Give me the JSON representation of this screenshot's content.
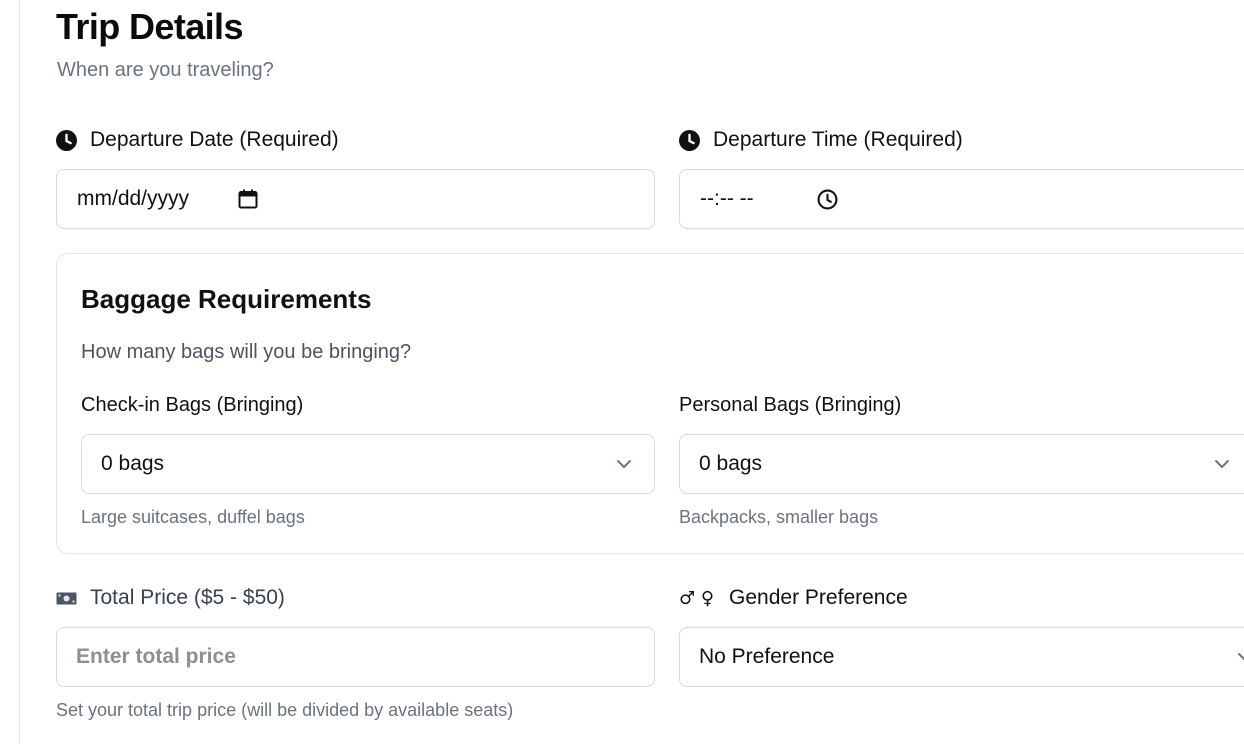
{
  "header": {
    "title": "Trip Details",
    "subtitle": "When are you traveling?"
  },
  "departure_date": {
    "label": "Departure Date (Required)",
    "value": "mm/dd/yyyy",
    "icon": "clock-icon"
  },
  "departure_time": {
    "label": "Departure Time (Required)",
    "value": "--:-- --",
    "icon": "clock-icon"
  },
  "baggage": {
    "title": "Baggage Requirements",
    "subtitle": "How many bags will you be bringing?",
    "checkin": {
      "label": "Check-in Bags (Bringing)",
      "value": "0 bags",
      "hint": "Large suitcases, duffel bags"
    },
    "personal": {
      "label": "Personal Bags (Bringing)",
      "value": "0 bags",
      "hint": "Backpacks, smaller bags"
    }
  },
  "price": {
    "label": "Total Price ($5 - $50)",
    "placeholder": "Enter total price",
    "hint": "Set your total trip price (will be divided by available seats)",
    "icon": "money-icon"
  },
  "gender": {
    "label": "Gender Preference",
    "value": "No Preference",
    "icon_glyphs": "♂ ♀"
  }
}
